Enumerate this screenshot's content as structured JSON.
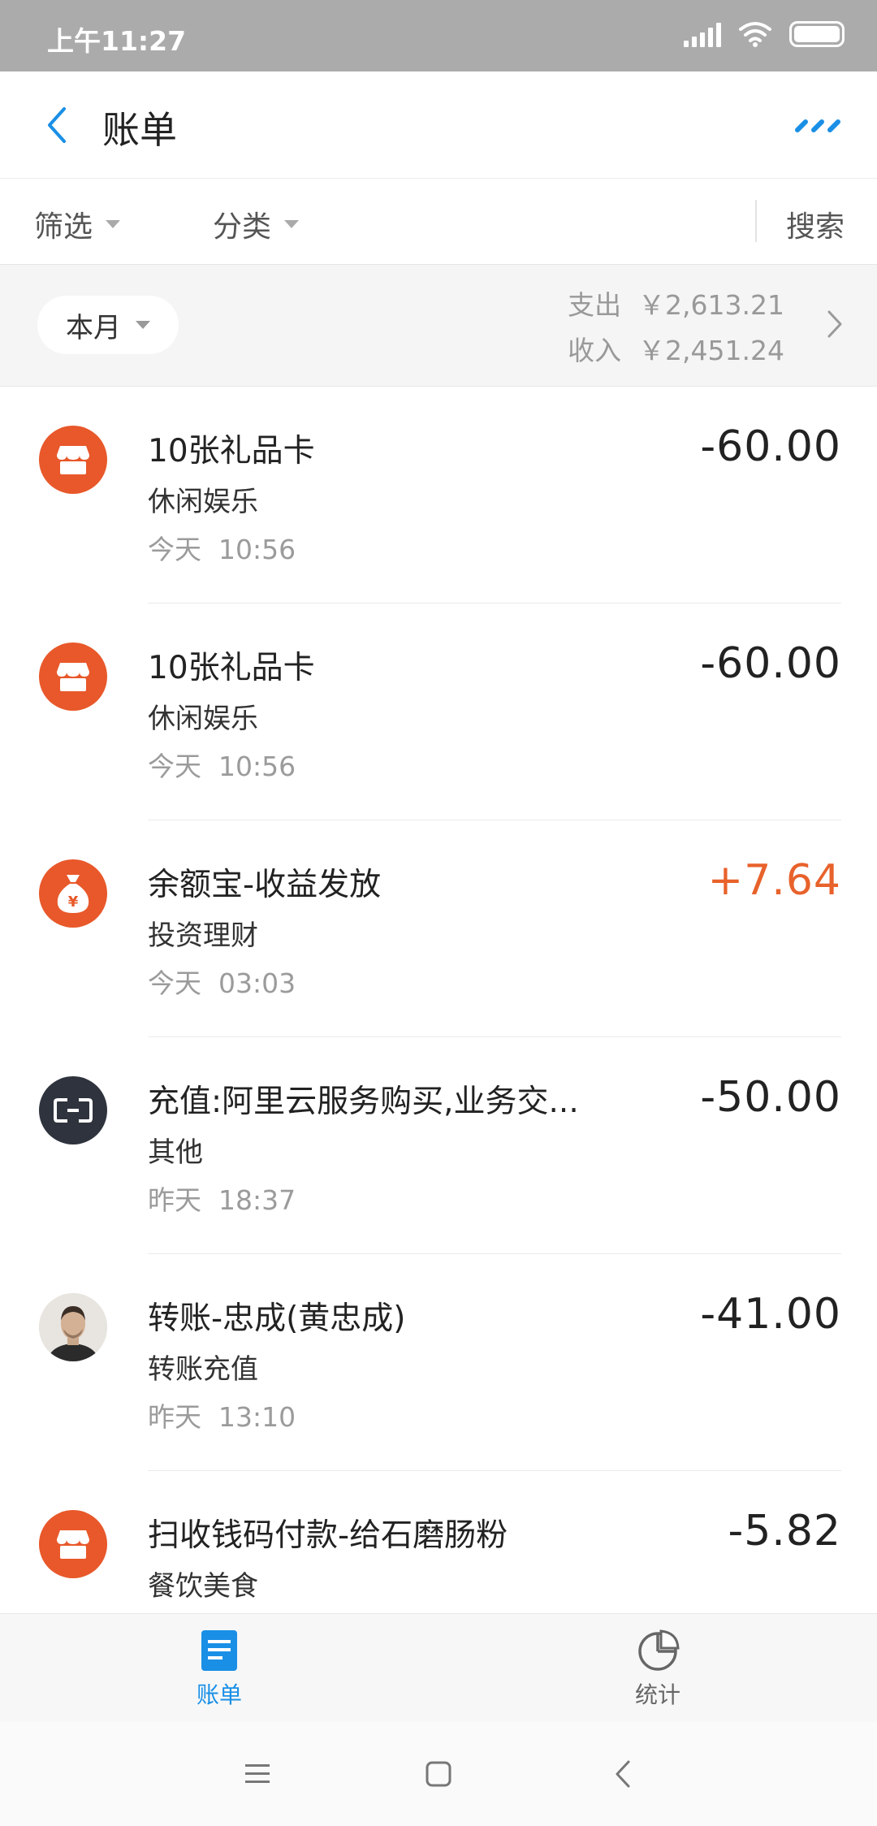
{
  "status_bar": {
    "time": "上午11:27"
  },
  "header": {
    "title": "账单"
  },
  "filters": {
    "filter_label": "筛选",
    "category_label": "分类",
    "search_label": "搜索"
  },
  "summary": {
    "period_label": "本月",
    "expense_label": "支出",
    "expense_value": "￥2,613.21",
    "income_label": "收入",
    "income_value": "￥2,451.24"
  },
  "transactions": [
    {
      "icon": "store-icon",
      "title": "10张礼品卡",
      "category": "休闲娱乐",
      "day": "今天",
      "time": "10:56",
      "amount": "-60.00",
      "type": "expense"
    },
    {
      "icon": "store-icon",
      "title": "10张礼品卡",
      "category": "休闲娱乐",
      "day": "今天",
      "time": "10:56",
      "amount": "-60.00",
      "type": "expense"
    },
    {
      "icon": "money-bag-icon",
      "title": "余额宝-收益发放",
      "category": "投资理财",
      "day": "今天",
      "time": "03:03",
      "amount": "+7.64",
      "type": "income"
    },
    {
      "icon": "aliyun-icon",
      "title": "充值:阿里云服务购买,业务交...",
      "category": "其他",
      "day": "昨天",
      "time": "18:37",
      "amount": "-50.00",
      "type": "expense"
    },
    {
      "icon": "avatar",
      "title": "转账-忠成(黄忠成)",
      "category": "转账充值",
      "day": "昨天",
      "time": "13:10",
      "amount": "-41.00",
      "type": "expense"
    },
    {
      "icon": "store-icon",
      "title": "扫收钱码付款-给石磨肠粉",
      "category": "餐饮美食",
      "day": "",
      "time": "",
      "amount": "-5.82",
      "type": "expense"
    }
  ],
  "tabs": [
    {
      "label": "账单",
      "icon": "bill-icon",
      "active": true
    },
    {
      "label": "统计",
      "icon": "pie-chart-icon",
      "active": false
    }
  ],
  "colors": {
    "accent": "#1a8fe6",
    "orange": "#e8582a",
    "income": "#e8622b"
  }
}
